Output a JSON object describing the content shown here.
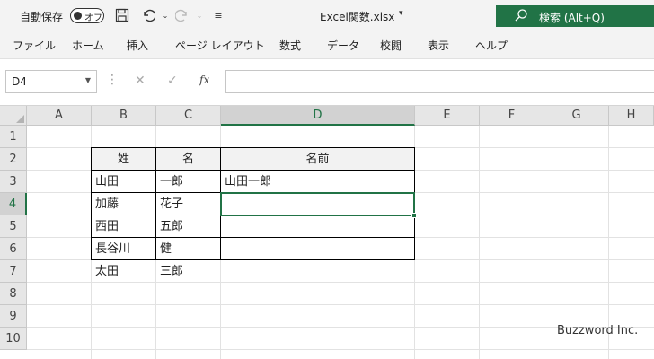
{
  "titlebar": {
    "autosave_label": "自動保存",
    "autosave_state": "オフ",
    "doc_title": "Excel関数.xlsx",
    "search_label": "検索 (Alt+Q)",
    "icons": [
      "save-icon",
      "undo-icon",
      "redo-icon",
      "customize-quick-access-icon",
      "search-icon"
    ],
    "accent": "#217346"
  },
  "menu": [
    "ファイル",
    "ホーム",
    "挿入",
    "ページ レイアウト",
    "数式",
    "データ",
    "校閲",
    "表示",
    "ヘルプ"
  ],
  "formula_bar": {
    "name_box": "D4",
    "formula": ""
  },
  "columns": [
    "A",
    "B",
    "C",
    "D",
    "E",
    "F",
    "G",
    "H"
  ],
  "rows": [
    "1",
    "2",
    "3",
    "4",
    "5",
    "6",
    "7",
    "8",
    "9",
    "10"
  ],
  "selected_cell": "D4",
  "table": {
    "headers": [
      "姓",
      "名",
      "名前"
    ],
    "rows": [
      [
        "山田",
        "一郎",
        "山田一郎"
      ],
      [
        "加藤",
        "花子",
        ""
      ],
      [
        "西田",
        "五郎",
        ""
      ],
      [
        "長谷川",
        "健",
        ""
      ],
      [
        "太田",
        "三郎",
        ""
      ]
    ]
  },
  "watermark": "Buzzword Inc."
}
